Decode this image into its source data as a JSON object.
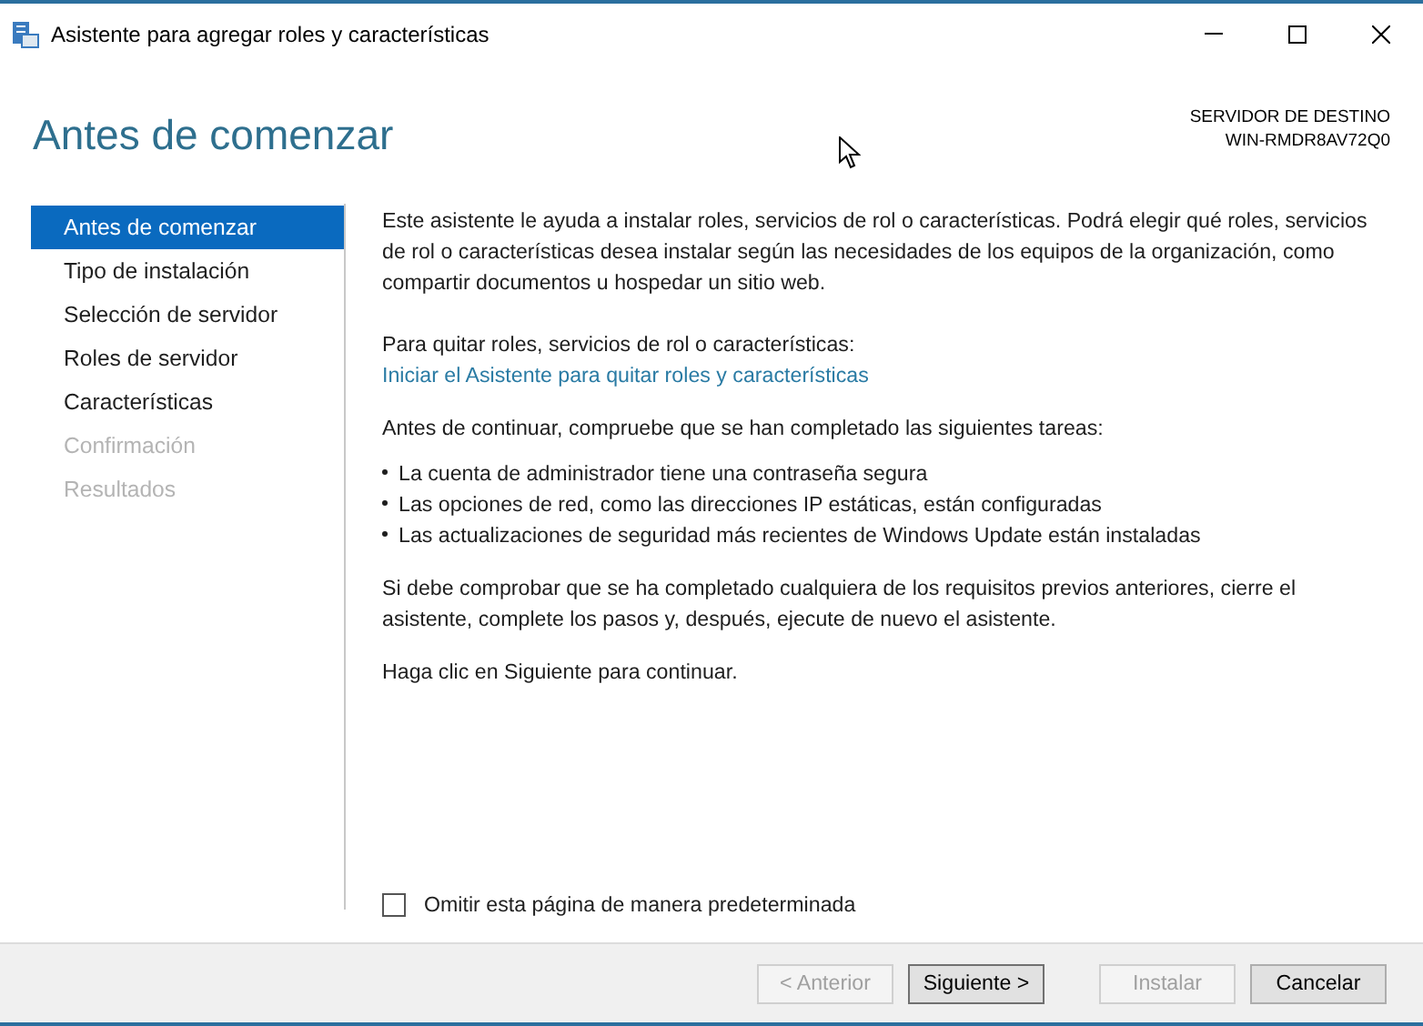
{
  "window": {
    "title": "Asistente para agregar roles y características"
  },
  "page_title": "Antes de comenzar",
  "destination": {
    "label": "SERVIDOR DE DESTINO",
    "server": "WIN-RMDR8AV72Q0"
  },
  "steps": [
    {
      "label": "Antes de comenzar",
      "selected": true,
      "disabled": false
    },
    {
      "label": "Tipo de instalación",
      "selected": false,
      "disabled": false
    },
    {
      "label": "Selección de servidor",
      "selected": false,
      "disabled": false
    },
    {
      "label": "Roles de servidor",
      "selected": false,
      "disabled": false
    },
    {
      "label": "Características",
      "selected": false,
      "disabled": false
    },
    {
      "label": "Confirmación",
      "selected": false,
      "disabled": true
    },
    {
      "label": "Resultados",
      "selected": false,
      "disabled": true
    }
  ],
  "content": {
    "intro": "Este asistente le ayuda a instalar roles, servicios de rol o características. Podrá elegir qué roles, servicios de rol o características desea instalar según las necesidades de los equipos de la organización, como compartir documentos u hospedar un sitio web.",
    "remove_label": "Para quitar roles, servicios de rol o características:",
    "remove_link": "Iniciar el Asistente para quitar roles y características",
    "checks_intro": "Antes de continuar, compruebe que se han completado las siguientes tareas:",
    "tasks": [
      "La cuenta de administrador tiene una contraseña segura",
      "Las opciones de red, como las direcciones IP estáticas, están configuradas",
      "Las actualizaciones de seguridad más recientes de Windows Update están instaladas"
    ],
    "note": "Si debe comprobar que se ha completado cualquiera de los requisitos previos anteriores, cierre el asistente, complete los pasos y, después, ejecute de nuevo el asistente.",
    "next_hint": "Haga clic en Siguiente para continuar."
  },
  "skip_checkbox": {
    "label": "Omitir esta página de manera predeterminada",
    "checked": false
  },
  "buttons": [
    {
      "label": "< Anterior",
      "disabled": true,
      "default": false
    },
    {
      "label": "Siguiente >",
      "disabled": false,
      "default": true
    },
    {
      "label": "Instalar",
      "disabled": true,
      "default": false
    },
    {
      "label": "Cancelar",
      "disabled": false,
      "default": false
    }
  ]
}
